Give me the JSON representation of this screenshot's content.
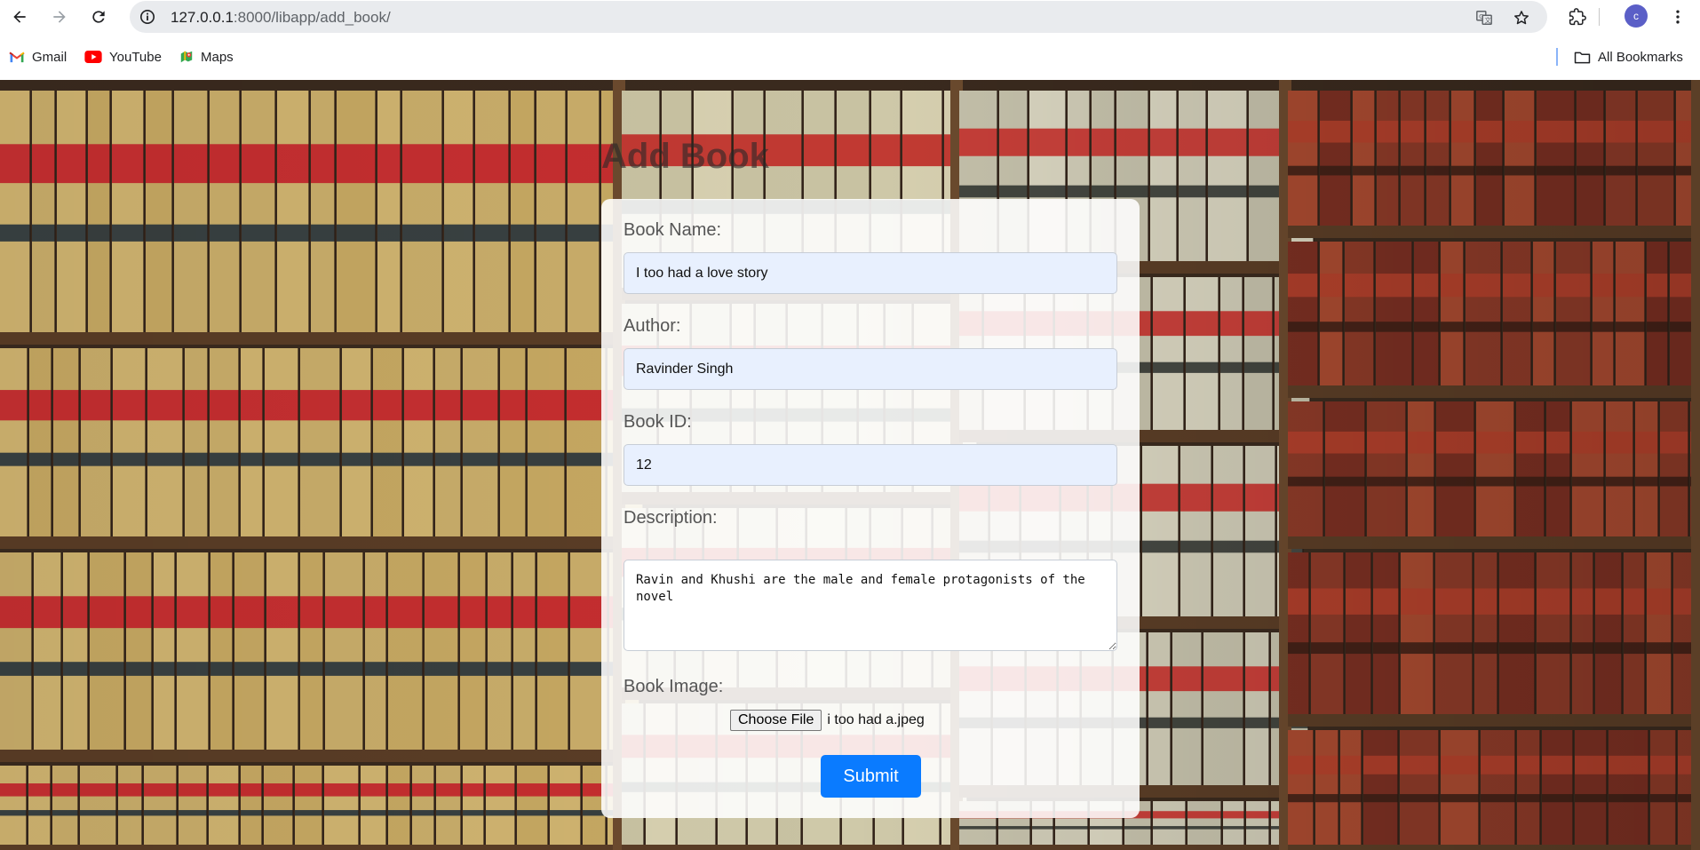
{
  "browser": {
    "url": {
      "host": "127.0.0.1",
      "rest": ":8000/libapp/add_book/"
    },
    "avatar_letter": "c",
    "bookmarks": [
      {
        "label": "Gmail",
        "icon": "gmail-icon"
      },
      {
        "label": "YouTube",
        "icon": "youtube-icon"
      },
      {
        "label": "Maps",
        "icon": "maps-icon"
      }
    ],
    "all_bookmarks_label": "All Bookmarks"
  },
  "page": {
    "title": "Add Book",
    "form": {
      "book_name": {
        "label": "Book Name:",
        "value": "I too had a love story"
      },
      "author": {
        "label": "Author:",
        "value": "Ravinder Singh"
      },
      "book_id": {
        "label": "Book ID:",
        "value": "12"
      },
      "description": {
        "label": "Description:",
        "value": "Ravin and Khushi are the male and female protagonists of the novel"
      },
      "book_image": {
        "label": "Book Image:",
        "button_label": "Choose File",
        "file_name": "i too had a.jpeg"
      },
      "submit_label": "Submit"
    },
    "colors": {
      "submit_button": "#0a7bff",
      "input_background": "#e8f0fe"
    }
  }
}
